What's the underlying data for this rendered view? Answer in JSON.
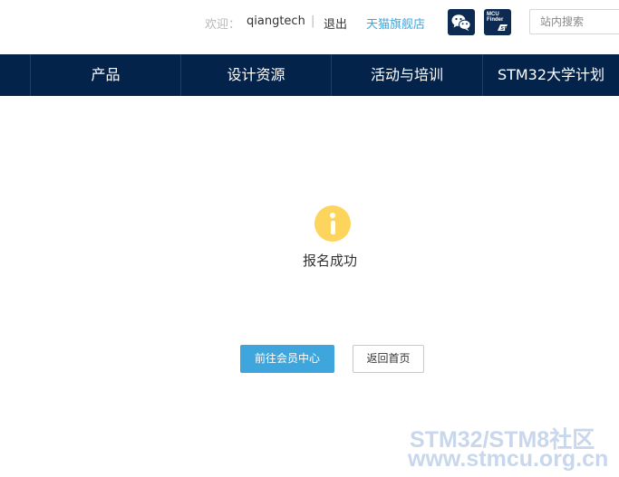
{
  "header": {
    "welcome_label": "欢迎：",
    "username": "qiangtech",
    "separator": "|",
    "logout_label": "退出",
    "tmall_label": "天猫旗舰店",
    "wechat_icon": "wechat-icon",
    "mcu_finder_icon": {
      "line1": "MCU",
      "line2": "Finder",
      "brand": "ST"
    },
    "search_placeholder": "站内搜索"
  },
  "nav": {
    "items": [
      {
        "label": "产品"
      },
      {
        "label": "设计资源"
      },
      {
        "label": "活动与培训"
      },
      {
        "label": "STM32大学计划"
      }
    ]
  },
  "main": {
    "status_icon": "info-icon",
    "message": "报名成功",
    "primary_button": "前往会员中心",
    "secondary_button": "返回首页"
  },
  "watermark": {
    "line1": "STM32/STM8社区",
    "line2": "www.stmcu.org.cn"
  },
  "colors": {
    "nav_bg": "#03234b",
    "accent": "#3ea6dc",
    "info_icon": "#fdd45c",
    "icon_box": "#0d2a52"
  }
}
